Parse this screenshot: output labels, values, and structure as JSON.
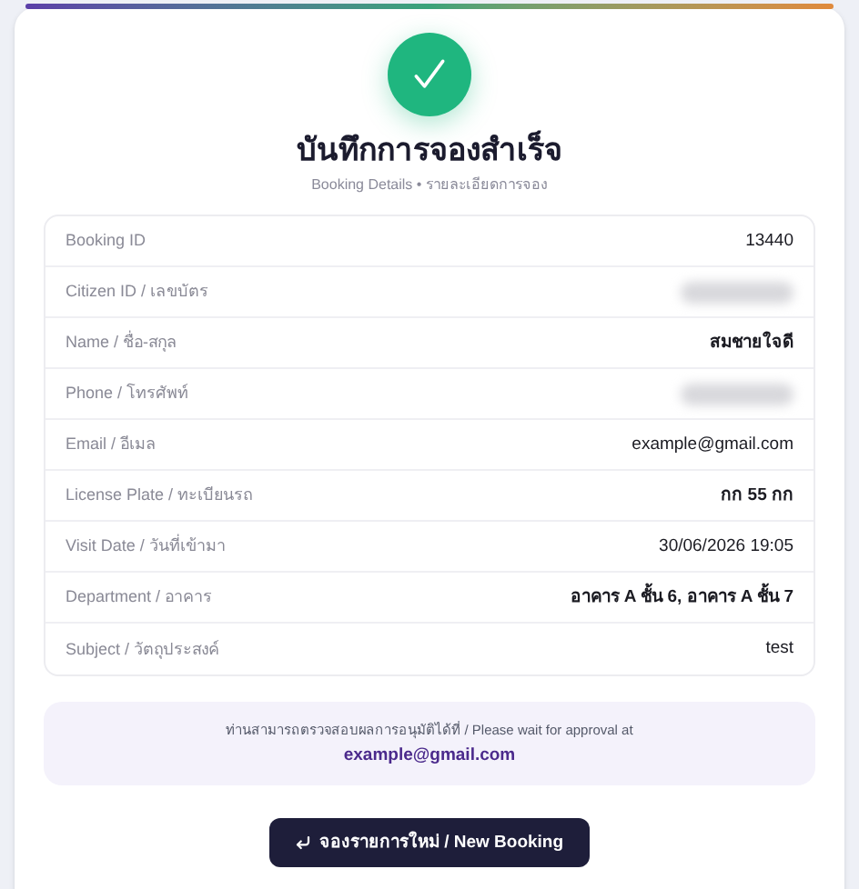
{
  "header": {
    "title": "บันทึกการจองสำเร็จ",
    "subtitle": "Booking Details • รายละเอียดการจอง"
  },
  "details": [
    {
      "label": "Booking ID",
      "value": "13440",
      "bold": false
    },
    {
      "label": "Citizen ID / เลขบัตร",
      "redacted": true
    },
    {
      "label": "Name / ชื่อ-สกุล",
      "value": "สมชายใจดี",
      "bold": true
    },
    {
      "label": "Phone / โทรศัพท์",
      "redacted": true
    },
    {
      "label": "Email / อีเมล",
      "value": "example@gmail.com",
      "bold": false
    },
    {
      "label": "License Plate / ทะเบียนรถ",
      "value": "กก 55 กก",
      "bold": true
    },
    {
      "label": "Visit Date / วันที่เข้ามา",
      "value": "30/06/2026 19:05",
      "bold": false
    },
    {
      "label": "Department / อาคาร",
      "value": "อาคาร A ชั้น 6, อาคาร A ชั้น 7",
      "bold": true
    },
    {
      "label": "Subject / วัตถุประสงค์",
      "value": "test",
      "bold": false
    }
  ],
  "notice": {
    "text": "ท่านสามารถตรวจสอบผลการอนุมัติได้ที่ / Please wait for approval at",
    "email": "example@gmail.com"
  },
  "button": {
    "label": "จองรายการใหม่ / New Booking"
  }
}
